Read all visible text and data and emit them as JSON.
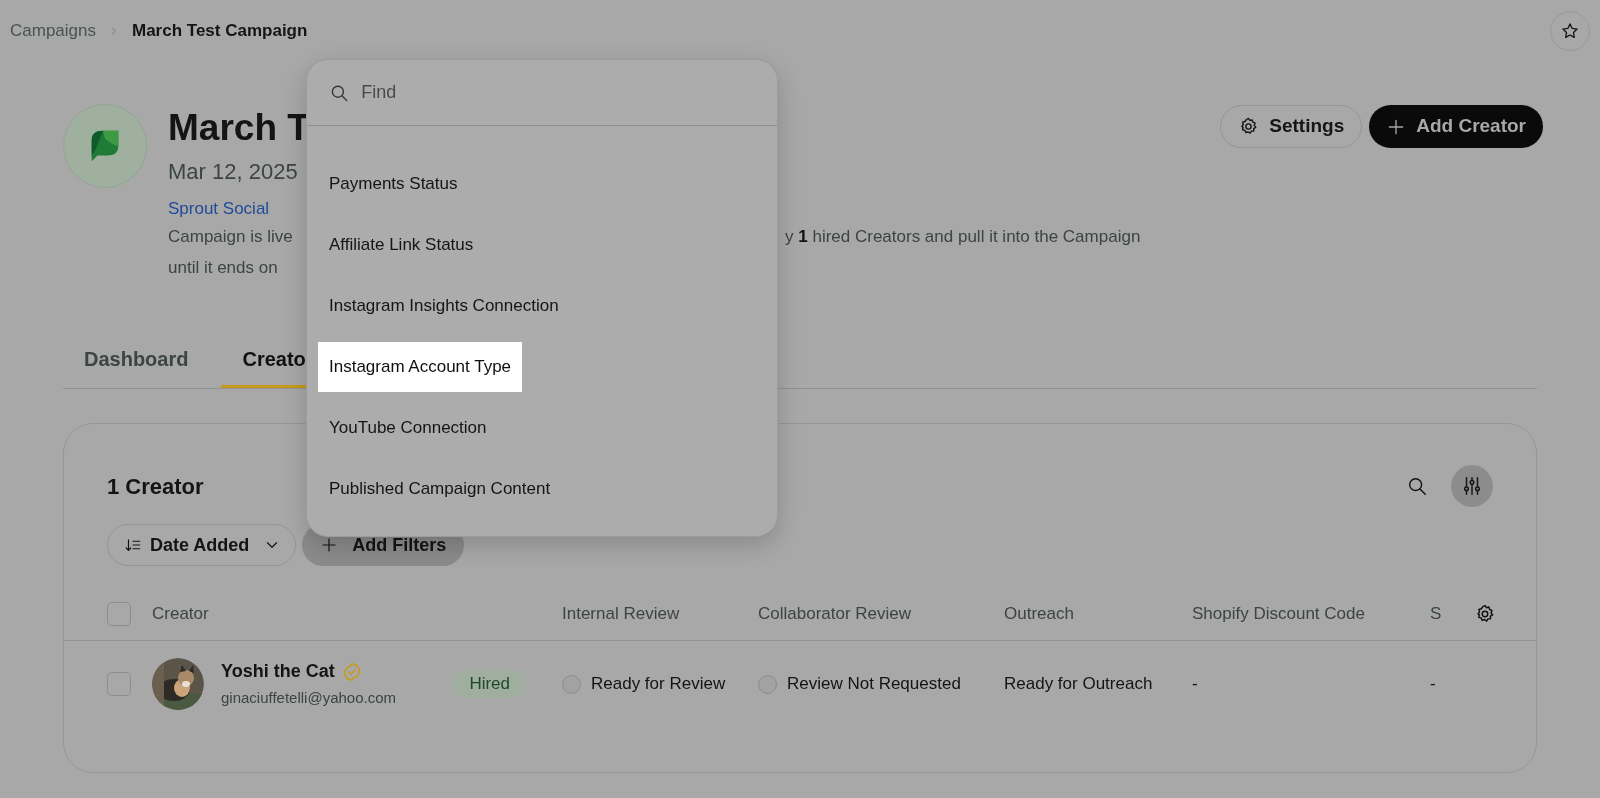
{
  "breadcrumb": [
    "Campaigns",
    "March Test Campaign"
  ],
  "campaign": {
    "title": "March T",
    "date": "Mar 12, 2025",
    "brand": "Sprout Social",
    "description_lines": [
      {
        "left": "Campaign is live",
        "right": "y **1** hired Creators and pull it into the Campaign"
      },
      {
        "left": "until it ends on"
      }
    ]
  },
  "header_buttons": [
    {
      "kind": "settings",
      "label": "Settings"
    },
    {
      "kind": "add",
      "label": "Add Creator"
    }
  ],
  "tabs": [
    {
      "label": "Dashboard",
      "selected": false
    },
    {
      "label": "Creato",
      "selected": true
    }
  ],
  "creators_panel": {
    "count_title": "1 Creator",
    "sort": {
      "label": "Date Added"
    },
    "add_filters": {
      "label": "Add Filters",
      "active": true
    },
    "select_all_checked": false,
    "columns": [
      "Creator",
      "Internal Review",
      "Collaborator Review",
      "Outreach",
      "Shopify Discount Code",
      "S"
    ],
    "rows": [
      {
        "checked": false,
        "name": "Yoshi the Cat",
        "verified": true,
        "email": "ginaciuffetelli@yahoo.com",
        "status": "Hired",
        "internal_review": "Ready for Review",
        "internal_review_checked": false,
        "collaborator_review": "Review Not Requested",
        "collaborator_review_checked": false,
        "outreach": "Ready for Outreach",
        "discount_code": "-",
        "column_6": "-"
      }
    ]
  },
  "filter_menu": {
    "search": {
      "placeholder": "Find"
    },
    "items": [
      {
        "label": "Payments Status",
        "selected": false
      },
      {
        "label": "Affiliate Link Status",
        "selected": false
      },
      {
        "label": "Instagram Insights Connection",
        "selected": false
      },
      {
        "label": "Instagram Account Type",
        "selected": true
      },
      {
        "label": "YouTube Connection",
        "selected": false
      },
      {
        "label": "Published Campaign Content",
        "selected": false
      }
    ]
  }
}
